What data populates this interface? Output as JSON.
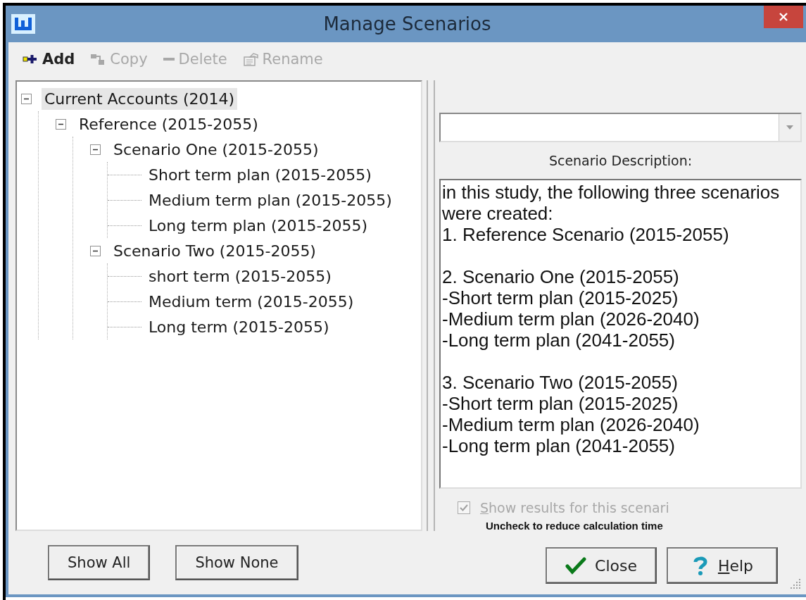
{
  "window": {
    "title": "Manage Scenarios"
  },
  "toolbar": [
    {
      "kind": "add",
      "label": "Add",
      "disabled": false
    },
    {
      "kind": "copy",
      "label": "Copy",
      "disabled": true
    },
    {
      "kind": "delete",
      "label": "Delete",
      "disabled": true
    },
    {
      "kind": "rename",
      "label": "Rename",
      "disabled": true
    }
  ],
  "tree": [
    {
      "label": "Current Accounts (2014)",
      "selected": true,
      "expanded": true,
      "children": [
        {
          "label": "Reference (2015-2055)",
          "selected": false,
          "expanded": true,
          "children": [
            {
              "label": "Scenario One (2015-2055)",
              "selected": false,
              "expanded": true,
              "children": [
                {
                  "label": "Short term plan (2015-2055)",
                  "selected": false
                },
                {
                  "label": "Medium term plan (2015-2055)",
                  "selected": false
                },
                {
                  "label": "Long term plan (2015-2055)",
                  "selected": false
                }
              ]
            },
            {
              "label": "Scenario Two (2015-2055)",
              "selected": false,
              "expanded": true,
              "children": [
                {
                  "label": "short term (2015-2055)",
                  "selected": false
                },
                {
                  "label": "Medium term (2015-2055)",
                  "selected": false
                },
                {
                  "label": "Long term (2015-2055)",
                  "selected": false
                }
              ]
            }
          ]
        }
      ]
    }
  ],
  "left_buttons": [
    "Show All",
    "Show None"
  ],
  "description_label": "Scenario Description:",
  "description": "in this study, the following three scenarios were created:\n1. Reference Scenario (2015-2055)\n\n2. Scenario One (2015-2055)\n-Short term plan (2015-2025)\n-Medium term plan (2026-2040)\n-Long term plan (2041-2055)\n\n3. Scenario Two (2015-2055)\n-Short term plan (2015-2025)\n-Medium term plan (2026-2040)\n-Long term plan (2041-2055)",
  "show_results": {
    "label": "Show results for this scenari",
    "underline_first": true,
    "checked": true,
    "disabled": true
  },
  "hint": "Uncheck to reduce calculation time",
  "dialog_buttons": [
    {
      "kind": "close",
      "label": "Close",
      "underline_first": false
    },
    {
      "kind": "help",
      "label": "Help",
      "underline_first": true
    }
  ]
}
